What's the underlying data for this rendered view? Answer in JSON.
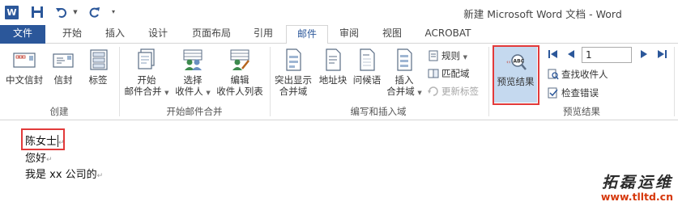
{
  "title_bar": {
    "app_icon": "word-icon",
    "app_icon_letter": "W",
    "window_title": "新建 Microsoft Word 文档 - Word"
  },
  "tabs": [
    {
      "label": "文件"
    },
    {
      "label": "开始"
    },
    {
      "label": "插入"
    },
    {
      "label": "设计"
    },
    {
      "label": "页面布局"
    },
    {
      "label": "引用"
    },
    {
      "label": "邮件"
    },
    {
      "label": "审阅"
    },
    {
      "label": "视图"
    },
    {
      "label": "ACROBAT"
    }
  ],
  "active_tab": "邮件",
  "ribbon": {
    "create": {
      "label": "创建",
      "buttons": [
        {
          "label": "中文信封",
          "icon": "envelope-icon"
        },
        {
          "label": "信封",
          "icon": "envelope-icon"
        },
        {
          "label": "标签",
          "icon": "labels-icon"
        }
      ]
    },
    "start_merge": {
      "label": "开始邮件合并",
      "buttons": [
        {
          "line1": "开始",
          "line2": "邮件合并",
          "icon": "document-merge-icon"
        },
        {
          "line1": "选择",
          "line2": "收件人",
          "icon": "recipients-icon"
        },
        {
          "line1": "编辑",
          "line2": "收件人列表",
          "icon": "edit-recipients-icon"
        }
      ]
    },
    "write_insert": {
      "label": "编写和插入域",
      "big_buttons": [
        {
          "line1": "突出显示",
          "line2": "合并域",
          "icon": "highlight-fields-icon"
        },
        {
          "label": "地址块",
          "icon": "address-block-icon"
        },
        {
          "label": "问候语",
          "icon": "greeting-line-icon"
        },
        {
          "line1": "插入",
          "line2": "合并域",
          "icon": "insert-field-icon"
        }
      ],
      "small_buttons": [
        {
          "label": "规则",
          "icon": "rules-icon",
          "enabled": true
        },
        {
          "label": "匹配域",
          "icon": "match-fields-icon",
          "enabled": true
        },
        {
          "label": "更新标签",
          "icon": "update-labels-icon",
          "enabled": false
        }
      ]
    },
    "preview": {
      "label": "预览结果",
      "preview_button": {
        "label": "预览结果",
        "icon": "preview-abc-icon"
      },
      "record_value": "1",
      "small_buttons": [
        {
          "label": "查找收件人",
          "icon": "find-recipient-icon"
        },
        {
          "label": "检查错误",
          "icon": "check-errors-icon"
        }
      ]
    }
  },
  "document": {
    "lines": [
      {
        "text": "陈女士"
      },
      {
        "text": "您好"
      },
      {
        "text": "我是 xx 公司的"
      }
    ],
    "paragraph_mark": "↵"
  },
  "watermark": {
    "line1": "拓磊运维",
    "line2": "www.tlltd.cn"
  },
  "colors": {
    "word_blue": "#2b579a",
    "highlight_red": "#e23a3a",
    "preview_selected_bg": "#c5d9ef"
  }
}
